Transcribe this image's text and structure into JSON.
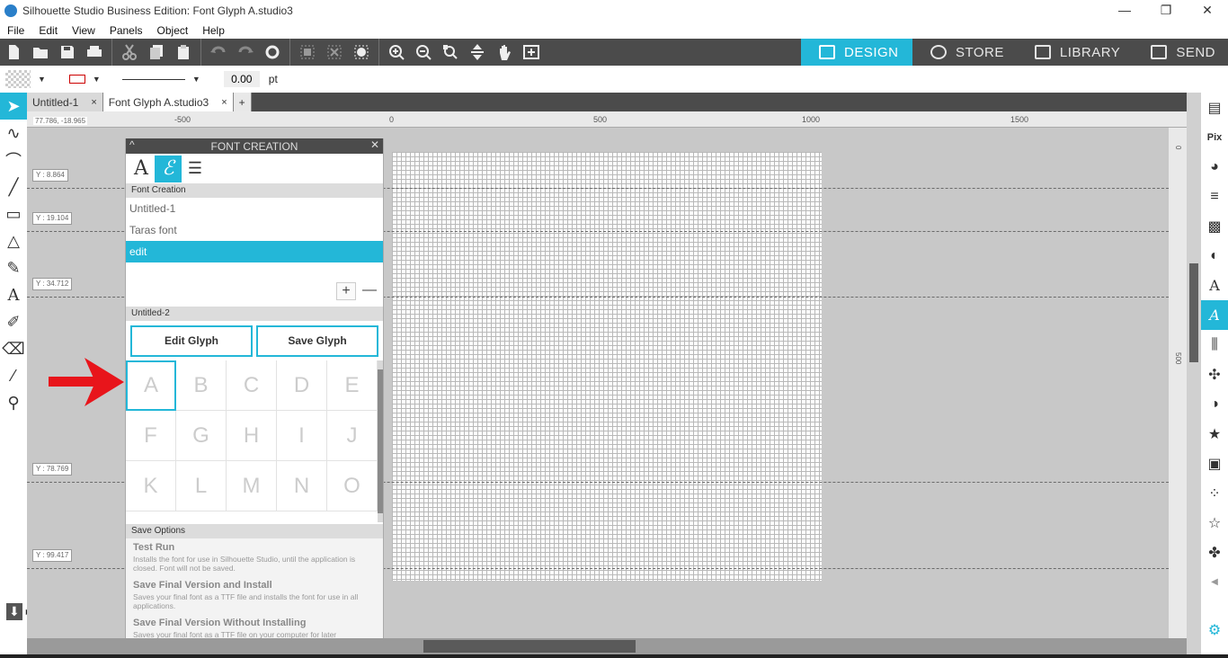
{
  "window": {
    "title": "Silhouette Studio Business Edition: Font Glyph A.studio3",
    "controls": [
      "—",
      "❐",
      "✕"
    ]
  },
  "menu": [
    "File",
    "Edit",
    "View",
    "Panels",
    "Object",
    "Help"
  ],
  "nav_tabs": [
    {
      "label": "DESIGN",
      "active": true
    },
    {
      "label": "STORE",
      "active": false
    },
    {
      "label": "LIBRARY",
      "active": false
    },
    {
      "label": "SEND",
      "active": false
    }
  ],
  "properties": {
    "line_thickness": "0.00",
    "unit": "pt"
  },
  "doc_tabs": [
    {
      "label": "Untitled-1",
      "close": "×"
    },
    {
      "label": "Font Glyph A.studio3",
      "close": "×"
    }
  ],
  "doc_tabs_add": "+",
  "ruler": {
    "coord_readout": "77.786, -18.965",
    "h_ticks": [
      "-500",
      "0",
      "500",
      "1000",
      "1500"
    ],
    "v_ticks": [
      "0",
      "500"
    ]
  },
  "guides": [
    {
      "label": "Y : 8.864"
    },
    {
      "label": "Y : 19.104"
    },
    {
      "label": "Y : 34.712"
    },
    {
      "label": "Y : 78.769"
    },
    {
      "label": "Y : 99.417"
    }
  ],
  "panel": {
    "title": "FONT CREATION",
    "collapse": "^",
    "close": "✕",
    "section_font_creation": "Font Creation",
    "fonts": [
      {
        "name": "Untitled-1",
        "selected": false
      },
      {
        "name": "Taras font",
        "selected": false
      },
      {
        "name": "edit",
        "selected": true
      }
    ],
    "add": "+",
    "remove": "—",
    "section_current": "Untitled-2",
    "edit_glyph": "Edit Glyph",
    "save_glyph": "Save Glyph",
    "glyphs": [
      "A",
      "B",
      "C",
      "D",
      "E",
      "F",
      "G",
      "H",
      "I",
      "J",
      "K",
      "L",
      "M",
      "N",
      "O"
    ],
    "section_save": "Save Options",
    "save_options": [
      {
        "title": "Test Run",
        "desc": "Installs the font for use in Silhouette Studio, until the application is closed. Font will not be saved."
      },
      {
        "title": "Save Final Version and Install",
        "desc": "Saves your final font as a TTF file and installs the font for use in all applications."
      },
      {
        "title": "Save Final Version Without Installing",
        "desc": "Saves your final font as a TTF file on your computer for later"
      }
    ]
  },
  "colors": {
    "accent": "#23b7d8",
    "toolbar": "#4b4b4b",
    "arrow": "#e8151b"
  }
}
